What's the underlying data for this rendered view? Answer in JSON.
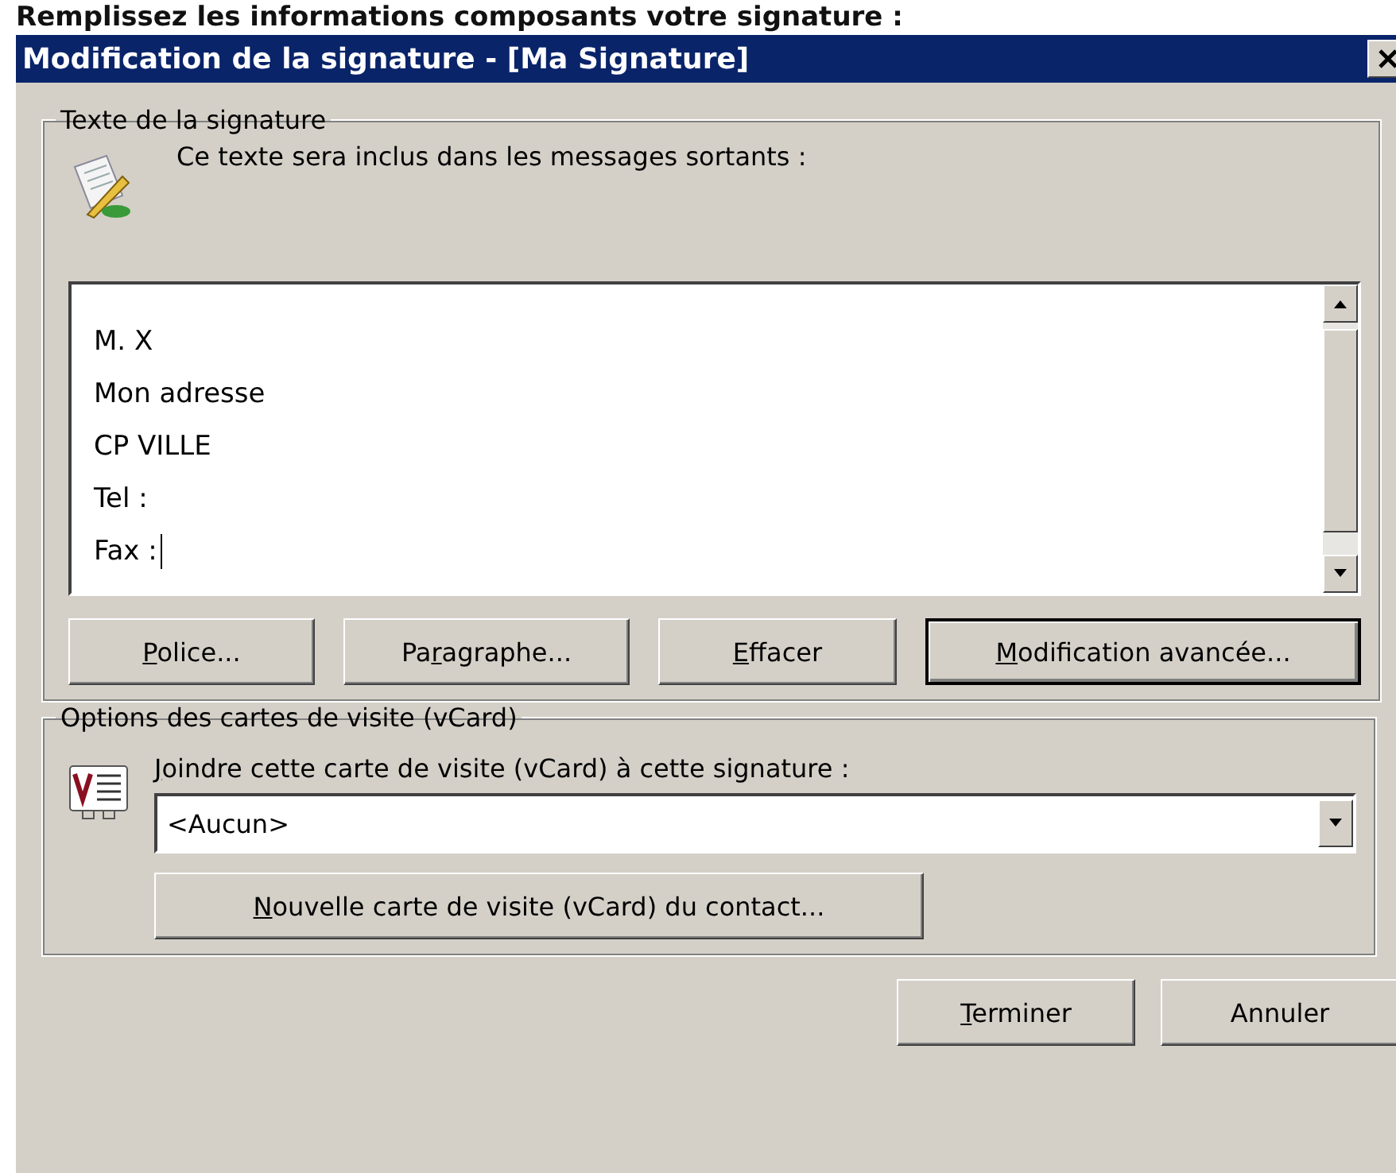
{
  "caption": "Remplissez les informations composants votre signature :",
  "window": {
    "title": "Modification de la signature - [Ma Signature]"
  },
  "signature_group": {
    "legend": "Texte de la signature",
    "description": "Ce texte sera inclus dans les messages sortants :",
    "lines": [
      {
        "text": "M. X",
        "caret": false
      },
      {
        "text": "Mon adresse",
        "caret": false
      },
      {
        "text": "CP VILLE",
        "caret": false
      },
      {
        "text": "Tel :",
        "caret": false
      },
      {
        "text": "Fax :",
        "caret": true
      }
    ],
    "buttons": [
      {
        "label": {
          "underlined": "P",
          "rest": "olice..."
        },
        "default": false
      },
      {
        "label": {
          "before": "Pa",
          "underlined": "r",
          "rest": "agraphe..."
        },
        "default": false
      },
      {
        "label": {
          "underlined": "E",
          "rest": "ffacer"
        },
        "default": false
      },
      {
        "label": {
          "underlined": "M",
          "rest": "odification avancée..."
        },
        "default": true
      }
    ]
  },
  "vcard_group": {
    "legend": "Options des cartes de visite (vCard)",
    "label": {
      "underlined": "J",
      "rest": "oindre cette carte de visite (vCard) à cette signature :"
    },
    "value": "<Aucun>",
    "button": {
      "label": {
        "underlined": "N",
        "rest": "ouvelle carte de visite (vCard) du contact..."
      }
    }
  },
  "footer_buttons": [
    {
      "label": {
        "underlined": "T",
        "rest": "erminer"
      }
    },
    {
      "label": {
        "rest": "Annuler"
      }
    }
  ]
}
